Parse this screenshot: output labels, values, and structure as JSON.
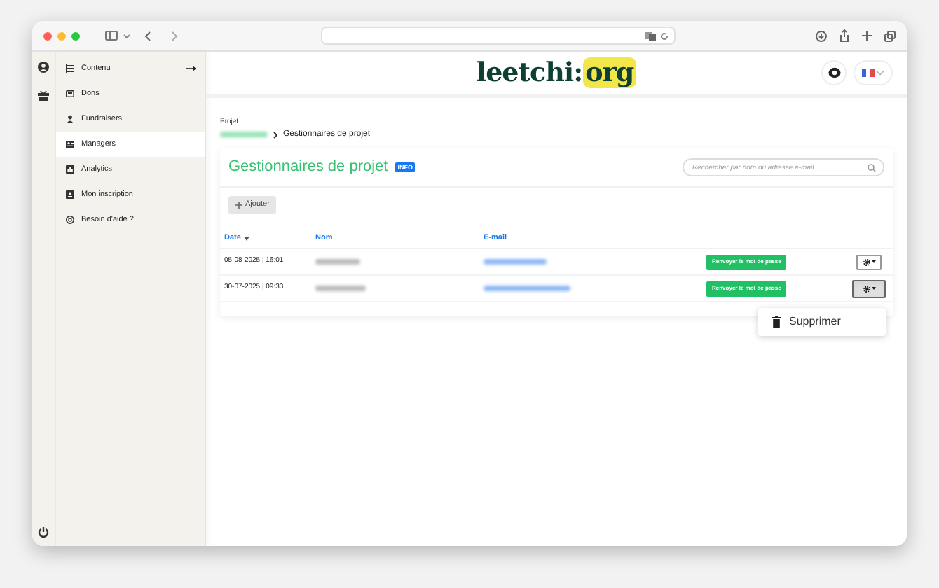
{
  "sidebar": {
    "items": [
      {
        "label": "Contenu",
        "selected": false
      },
      {
        "label": "Dons",
        "selected": false
      },
      {
        "label": "Fundraisers",
        "selected": false
      },
      {
        "label": "Managers",
        "selected": true
      },
      {
        "label": "Analytics",
        "selected": false
      },
      {
        "label": "Mon inscription",
        "selected": false
      },
      {
        "label": "Besoin d'aide ?",
        "selected": false
      }
    ]
  },
  "header": {
    "logo": {
      "text": "leetchi:",
      "highlight": "org"
    }
  },
  "breadcrumb": {
    "label": "Projet",
    "current": "Gestionnaires de projet"
  },
  "card": {
    "title": "Gestionnaires de projet",
    "badge": "INFO",
    "search": {
      "placeholder": "Rechercher par nom ou adresse e-mail"
    },
    "add_button": "Ajouter"
  },
  "table": {
    "columns": [
      {
        "label": "Date",
        "sorted": true
      },
      {
        "label": "Nom",
        "sorted": false
      },
      {
        "label": "E-mail",
        "sorted": false
      }
    ],
    "rows": [
      {
        "date": "05-08-2025 | 16:01",
        "action": "Renvoyer le mot de passe",
        "menu_open": false
      },
      {
        "date": "30-07-2025 | 09:33",
        "action": "Renvoyer le mot de passe",
        "menu_open": true
      }
    ]
  },
  "menu": {
    "items": [
      {
        "label": "Supprimer"
      }
    ]
  }
}
